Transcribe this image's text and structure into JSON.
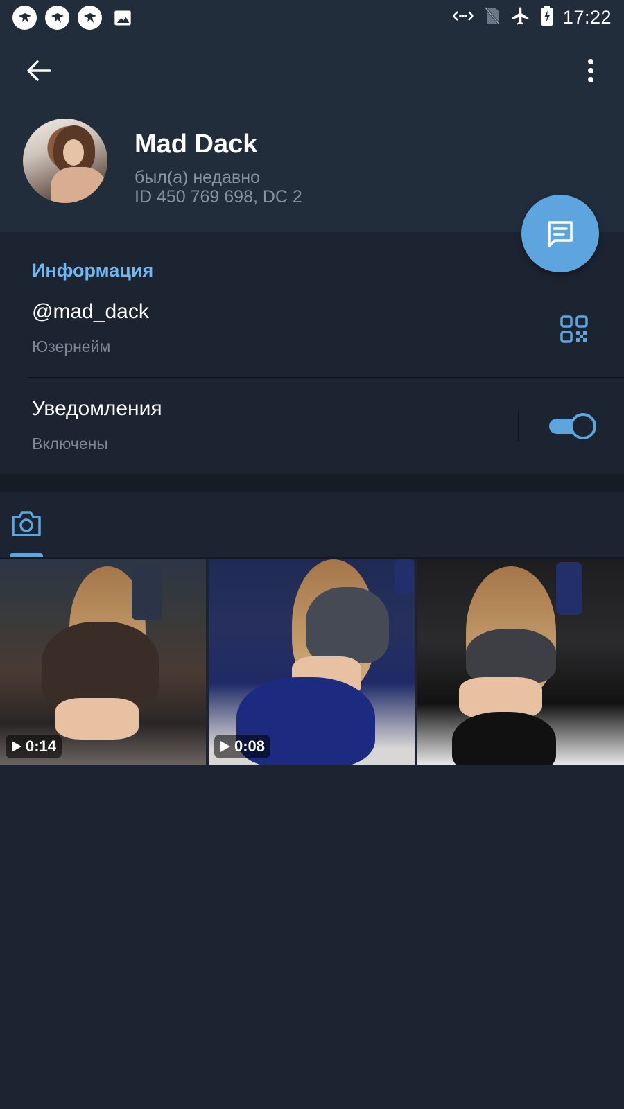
{
  "status_bar": {
    "time": "17:22",
    "left_icons": [
      "app-notification-icon",
      "app-notification-icon",
      "app-notification-icon",
      "image-icon"
    ],
    "right_icons": [
      "data-arrows-icon",
      "no-sim-icon",
      "airplane-icon",
      "battery-charging-icon"
    ]
  },
  "header": {
    "back_icon": "arrow-left-icon",
    "more_icon": "more-vertical-icon"
  },
  "profile": {
    "name": "Mad Dack",
    "status": "был(а) недавно",
    "id_line": "ID 450 769 698, DC 2"
  },
  "fab": {
    "icon": "message-icon"
  },
  "info": {
    "section_title": "Информация",
    "username": "@mad_dack",
    "username_label": "Юзернейм",
    "notifications_title": "Уведомления",
    "notifications_label": "Включены",
    "notifications_enabled": true
  },
  "media": {
    "active_tab_icon": "camera-icon",
    "items": [
      {
        "type": "video",
        "duration": "0:14"
      },
      {
        "type": "video",
        "duration": "0:08"
      },
      {
        "type": "photo"
      }
    ]
  },
  "colors": {
    "accent": "#5ea5e0",
    "section_title": "#71b7f1",
    "background": "#1d2431",
    "header": "#222d3b",
    "secondary_text": "#7b8796"
  }
}
